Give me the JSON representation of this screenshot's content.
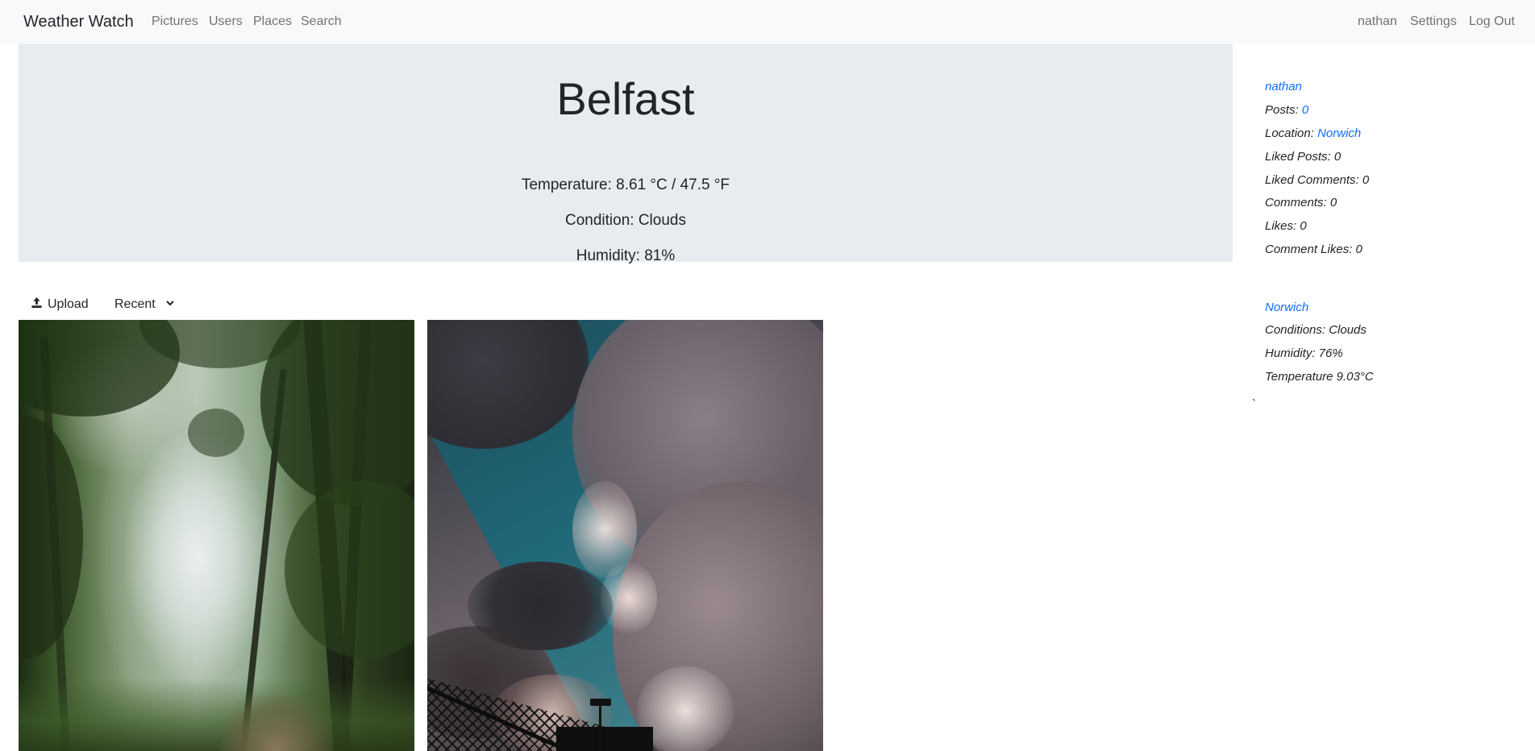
{
  "navbar": {
    "brand": "Weather Watch",
    "links": [
      "Pictures",
      "Users",
      "Places",
      "Search"
    ],
    "right_links": [
      "nathan",
      "Settings",
      "Log Out"
    ]
  },
  "weather": {
    "city": "Belfast",
    "temperature": "Temperature: 8.61 °C / 47.5 °F",
    "condition": "Condition: Clouds",
    "humidity": "Humidity: 81%"
  },
  "toolbar": {
    "upload_label": "Upload",
    "sort_selected": "Recent"
  },
  "pictures": [
    {
      "subject": "misty forest path"
    },
    {
      "subject": "storm clouds over fence"
    }
  ],
  "profile": {
    "username": "nathan",
    "posts_label": "Posts:",
    "posts_value": "0",
    "location_label": "Location:",
    "location_value": "Norwich",
    "liked_posts": "Liked Posts: 0",
    "liked_comments": "Liked Comments: 0",
    "comments": "Comments: 0",
    "likes": "Likes: 0",
    "comment_likes": "Comment Likes: 0"
  },
  "home_weather": {
    "city": "Norwich",
    "conditions": "Conditions: Clouds",
    "humidity": "Humidity: 76%",
    "temperature": "Temperature 9.03°C"
  },
  "stray_char": "`",
  "colors": {
    "navbar_bg": "#f8f9fa",
    "jumbotron_bg": "#e9ecef",
    "link": "#0d6efd"
  }
}
